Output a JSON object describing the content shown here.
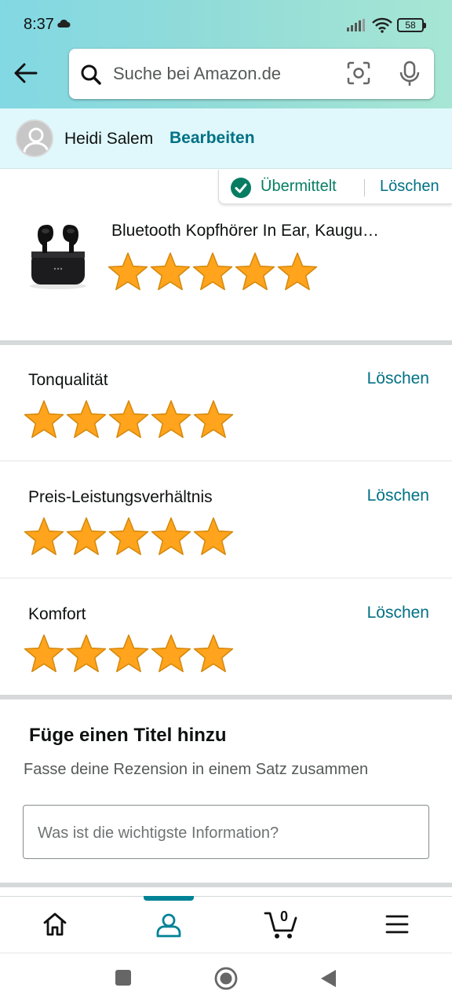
{
  "status_bar": {
    "time": "8:37",
    "battery": "58"
  },
  "search": {
    "placeholder": "Suche bei Amazon.de"
  },
  "user": {
    "name": "Heidi Salem",
    "edit_label": "Bearbeiten"
  },
  "submission": {
    "status": "Übermittelt",
    "delete_label": "Löschen"
  },
  "product": {
    "title": "Bluetooth Kopfhörer In Ear, Kaugu…",
    "rating": 5,
    "max_rating": 5
  },
  "aspects": [
    {
      "label": "Tonqualität",
      "rating": 5,
      "delete_label": "Löschen"
    },
    {
      "label": "Preis-Leistungsverhältnis",
      "rating": 5,
      "delete_label": "Löschen"
    },
    {
      "label": "Komfort",
      "rating": 5,
      "delete_label": "Löschen"
    }
  ],
  "title_section": {
    "heading": "Füge einen Titel hinzu",
    "subheading": "Fasse deine Rezension in einem Satz zusammen",
    "input_placeholder": "Was ist die wichtigste Information?",
    "input_value": ""
  },
  "bottom_nav": {
    "items": [
      {
        "icon": "home-icon"
      },
      {
        "icon": "user-icon",
        "active": true
      },
      {
        "icon": "cart-icon",
        "badge": "0"
      },
      {
        "icon": "menu-icon"
      }
    ]
  },
  "colors": {
    "accent": "#007185",
    "success": "#067d62",
    "star": "#ffa41c",
    "header_gradient_start": "#82d8e3",
    "header_gradient_end": "#a7e6d4"
  }
}
